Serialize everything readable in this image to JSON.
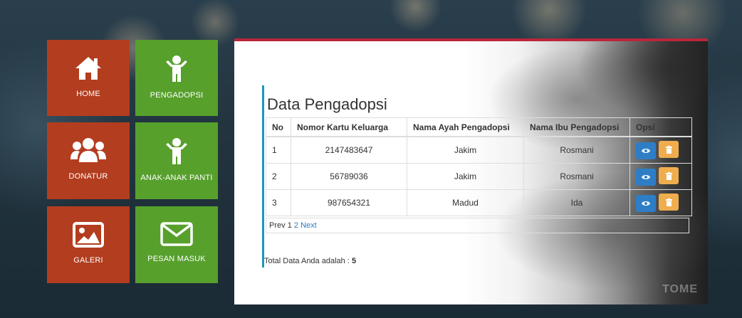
{
  "tiles": [
    {
      "label": "HOME",
      "icon": "home-icon",
      "color": "#b33d1f"
    },
    {
      "label": "PENGADOPSI",
      "icon": "child-icon",
      "color": "#57a02c"
    },
    {
      "label": "DONATUR",
      "icon": "users-icon",
      "color": "#b33d1f"
    },
    {
      "label": "ANAK-ANAK PANTI",
      "icon": "child-icon",
      "color": "#57a02c"
    },
    {
      "label": "GALERI",
      "icon": "image-icon",
      "color": "#b33d1f"
    },
    {
      "label": "PESAN MASUK",
      "icon": "envelope-icon",
      "color": "#57a02c"
    }
  ],
  "panel": {
    "title": "Data Pengadopsi",
    "accent_color": "#b8263b",
    "columns": [
      "No",
      "Nomor Kartu Keluarga",
      "Nama Ayah Pengadopsi",
      "Nama Ibu Pengadopsi",
      "Opsi"
    ],
    "rows": [
      {
        "no": "1",
        "kk": "2147483647",
        "ayah": "Jakim",
        "ibu": "Rosmani"
      },
      {
        "no": "2",
        "kk": "56789036",
        "ayah": "Jakim",
        "ibu": "Rosmani"
      },
      {
        "no": "3",
        "kk": "987654321",
        "ayah": "Madud",
        "ibu": "Ida"
      }
    ],
    "pager": {
      "prev": "Prev",
      "page1": "1",
      "page2": "2",
      "next": "Next"
    },
    "total_label": "Total Data Anda adalah :",
    "total_value": "5",
    "watermark": "TOME"
  }
}
